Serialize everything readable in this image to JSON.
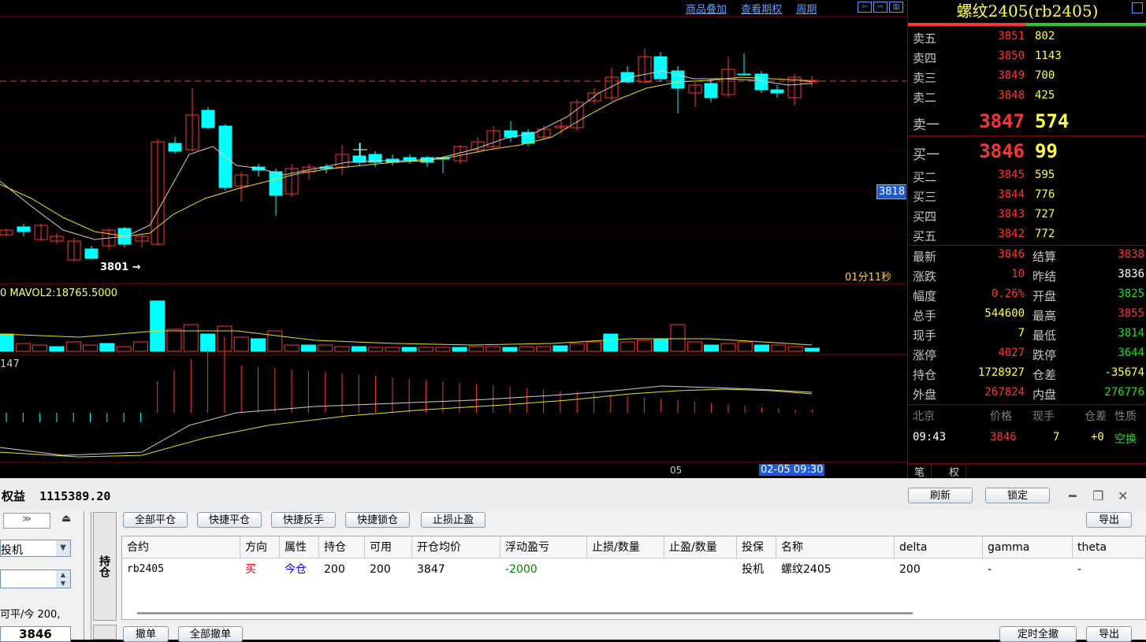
{
  "chart": {
    "links": [
      "商品叠加",
      "查看期权",
      "周期"
    ],
    "low_marker": "3801",
    "price_tag": "3818",
    "countdown": "01分11秒",
    "mavol_label": "0 MAVOL2:18765.5000",
    "macd_label": "147",
    "x_label_05": "05",
    "time_tag": "02-05 09:30"
  },
  "quote": {
    "title": "螺纹2405(rb2405)",
    "asks": [
      {
        "label": "卖五",
        "price": "3851",
        "vol": "802"
      },
      {
        "label": "卖四",
        "price": "3850",
        "vol": "1143"
      },
      {
        "label": "卖三",
        "price": "3849",
        "vol": "700"
      },
      {
        "label": "卖二",
        "price": "3848",
        "vol": "425"
      },
      {
        "label": "卖一",
        "price": "3847",
        "vol": "574"
      }
    ],
    "bids": [
      {
        "label": "买一",
        "price": "3846",
        "vol": "99"
      },
      {
        "label": "买二",
        "price": "3845",
        "vol": "595"
      },
      {
        "label": "买三",
        "price": "3844",
        "vol": "776"
      },
      {
        "label": "买四",
        "price": "3843",
        "vol": "727"
      },
      {
        "label": "买五",
        "price": "3842",
        "vol": "772"
      }
    ],
    "stats": [
      {
        "l1": "最新",
        "v1": "3846",
        "c1": "#ff3333",
        "l2": "结算",
        "v2": "3838",
        "c2": "#ff3333"
      },
      {
        "l1": "涨跌",
        "v1": "10",
        "c1": "#ff3333",
        "l2": "昨结",
        "v2": "3836",
        "c2": "#ffffff"
      },
      {
        "l1": "幅度",
        "v1": "0.26%",
        "c1": "#ff3333",
        "l2": "开盘",
        "v2": "3825",
        "c2": "#22dd22"
      },
      {
        "l1": "总手",
        "v1": "544600",
        "c1": "#ffff44",
        "l2": "最高",
        "v2": "3855",
        "c2": "#ff3333"
      },
      {
        "l1": "现手",
        "v1": "7",
        "c1": "#ffff44",
        "l2": "最低",
        "v2": "3814",
        "c2": "#22dd22"
      },
      {
        "l1": "涨停",
        "v1": "4027",
        "c1": "#ff3333",
        "l2": "跌停",
        "v2": "3644",
        "c2": "#22dd22"
      },
      {
        "l1": "持仓",
        "v1": "1728927",
        "c1": "#ffff44",
        "l2": "仓差",
        "v2": "-35674",
        "c2": "#ffff44"
      },
      {
        "l1": "外盘",
        "v1": "267824",
        "c1": "#ff3333",
        "l2": "内盘",
        "v2": "276776",
        "c2": "#22dd22"
      }
    ],
    "tick_headers": [
      "北京",
      "价格",
      "现手",
      "仓差",
      "性质"
    ],
    "tick": {
      "time": "09:43",
      "price": "3846",
      "vol": "7",
      "oi": "+0",
      "nature": "空换"
    },
    "tabs": [
      "笔",
      "权"
    ]
  },
  "account": {
    "equity_label": "权益",
    "equity_value": "1115389.20",
    "refresh": "刷新",
    "lock": "锁定",
    "export": "导出"
  },
  "left": {
    "hedge_value": "投机",
    "info": "可平/今 200,",
    "price_value": "3846"
  },
  "positions": {
    "tab_label": "持仓",
    "actions": [
      "全部平仓",
      "快捷平仓",
      "快捷反手",
      "快捷锁仓",
      "止损止盈"
    ],
    "headers": [
      "合约",
      "方向",
      "属性",
      "持仓",
      "可用",
      "开仓均价",
      "浮动盈亏",
      "止损/数量",
      "止盈/数量",
      "投保",
      "名称",
      "delta",
      "gamma",
      "theta"
    ],
    "row": {
      "contract": "rb2405",
      "direction": "买",
      "attr": "今仓",
      "position": "200",
      "available": "200",
      "avg_price": "3847",
      "pnl": "-2000",
      "hedge": "投机",
      "name": "螺纹2405",
      "delta": "200",
      "gamma": "-",
      "theta": "-"
    }
  },
  "orders": {
    "actions": [
      "撤单",
      "全部撤单",
      "定时全撤",
      "导出"
    ]
  }
}
